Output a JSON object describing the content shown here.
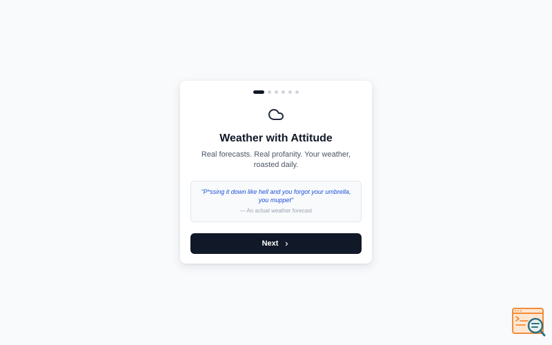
{
  "onboarding": {
    "step_count": 6,
    "current_step": 1,
    "icon": "cloud-icon",
    "title": "Weather with Attitude",
    "subtitle": "Real forecasts. Real profanity. Your weather, roasted daily.",
    "quote": {
      "text": "\"P*ssing it down like hell and you forgot your umbrella, you muppet\"",
      "source": "— An actual weather forecast"
    },
    "next_label": "Next",
    "next_icon": "chevron-right-icon"
  },
  "corner_badge": {
    "icon": "browser-search-icon",
    "colors": {
      "window": "#f28c38",
      "magnifier": "#2f6f7e"
    }
  },
  "colors": {
    "background": "#f8fafc",
    "card": "#ffffff",
    "primary": "#111827",
    "quote_text": "#1d4ed8",
    "muted": "#9ca3af"
  }
}
